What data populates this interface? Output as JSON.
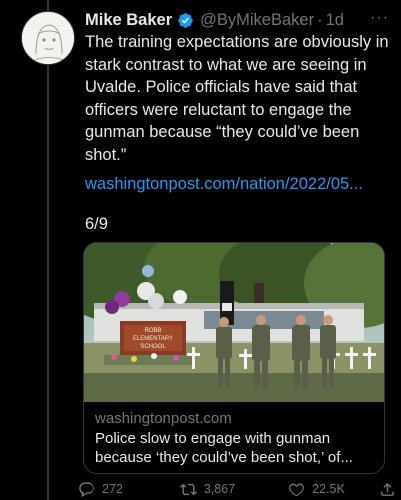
{
  "tweet": {
    "author_name": "Mike Baker",
    "handle": "@ByMikeBaker",
    "separator": "·",
    "time": "1d",
    "more_label": "···",
    "text": "The training expectations are obviously in stark contrast to what we are seeing in Uvalde. Police officials have said that officers were reluctant to engage the gunman because “they could’ve been shot.”",
    "link": "washingtonpost.com/nation/2022/05...",
    "thread_position": "6/9"
  },
  "card": {
    "domain": "washingtonpost.com",
    "title": "Police slow to engage with gunman because ‘they could’ve been shot,’ of...",
    "sign_text": [
      "ROBB",
      "ELEMENTARY",
      "SCHOOL"
    ]
  },
  "actions": {
    "replies": "272",
    "retweets": "3,867",
    "likes": "22.5K"
  },
  "colors": {
    "background": "#000000",
    "text": "#e7e9ea",
    "muted": "#71767b",
    "link": "#1d9bf0",
    "verified": "#1d9bf0"
  },
  "icons": {
    "verified": "verified-badge-icon",
    "reply": "reply-icon",
    "retweet": "retweet-icon",
    "like": "heart-icon",
    "share": "share-icon",
    "more": "more-icon"
  }
}
